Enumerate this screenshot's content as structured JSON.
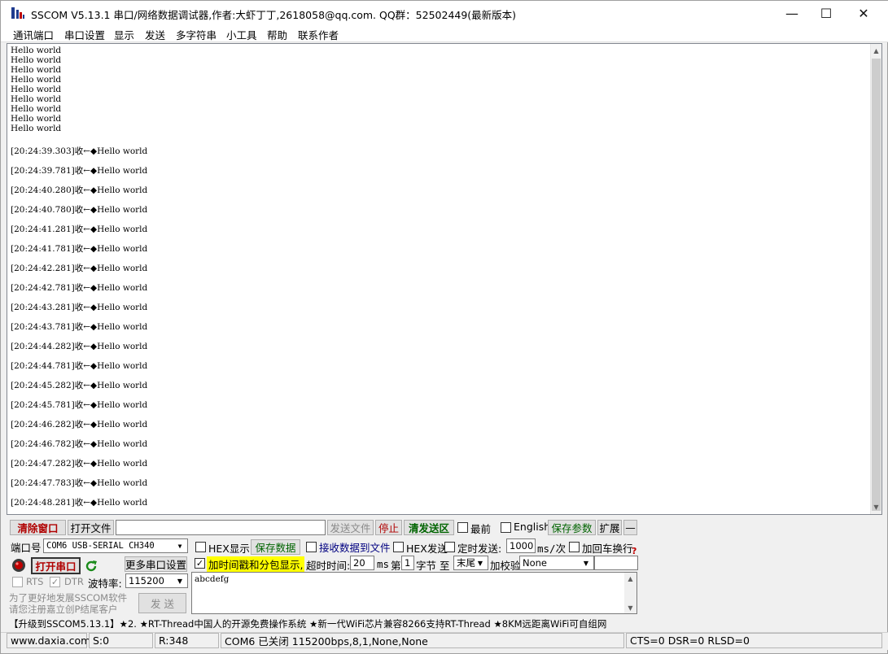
{
  "window": {
    "title": "SSCOM V5.13.1 串口/网络数据调试器,作者:大虾丁丁,2618058@qq.com. QQ群：52502449(最新版本)",
    "minimize": "—",
    "maximize": "☐",
    "close": "✕"
  },
  "menu": [
    "通讯端口",
    "串口设置",
    "显示",
    "发送",
    "多字符串",
    "小工具",
    "帮助",
    "联系作者"
  ],
  "receive": {
    "lines": [
      "Hello world",
      "Hello world",
      "Hello world",
      "Hello world",
      "Hello world",
      "Hello world",
      "Hello world",
      "Hello world",
      "Hello world"
    ],
    "timestamped": [
      "[20:24:39.303]收←◆Hello world",
      "[20:24:39.781]收←◆Hello world",
      "[20:24:40.280]收←◆Hello world",
      "[20:24:40.780]收←◆Hello world",
      "[20:24:41.281]收←◆Hello world",
      "[20:24:41.781]收←◆Hello world",
      "[20:24:42.281]收←◆Hello world",
      "[20:24:42.781]收←◆Hello world",
      "[20:24:43.281]收←◆Hello world",
      "[20:24:43.781]收←◆Hello world",
      "[20:24:44.282]收←◆Hello world",
      "[20:24:44.781]收←◆Hello world",
      "[20:24:45.282]收←◆Hello world",
      "[20:24:45.781]收←◆Hello world",
      "[20:24:46.282]收←◆Hello world",
      "[20:24:46.782]收←◆Hello world",
      "[20:24:47.282]收←◆Hello world",
      "[20:24:47.783]收←◆Hello world",
      "[20:24:48.281]收←◆Hello world"
    ]
  },
  "toolbar": {
    "clear_window": "清除窗口",
    "open_file": "打开文件",
    "file_path": "",
    "send_file": "发送文件",
    "stop": "停止",
    "clear_send": "清发送区",
    "topmost": "最前",
    "english": "English",
    "save_params": "保存参数",
    "expand": "扩展",
    "collapse": "—"
  },
  "port": {
    "port_label": "端口号",
    "port_value": "COM6 USB-SERIAL CH340",
    "open_port": "打开串口",
    "more_settings": "更多串口设置",
    "rts": "RTS",
    "dtr": "DTR",
    "baud_label": "波特率:",
    "baud_value": "115200"
  },
  "options": {
    "hex_display": "HEX显示",
    "save_data": "保存数据",
    "recv_to_file": "接收数据到文件",
    "hex_send": "HEX发送",
    "timed_send": "定时发送:",
    "interval_value": "1000",
    "interval_unit": "ms/次",
    "add_crlf": "加回车换行",
    "timestamp_split": "加时间戳和分包显示,",
    "timeout_label": "超时时间:",
    "timeout_value": "20",
    "timeout_unit": "ms",
    "byte_prefix": "第",
    "byte_value": "1",
    "byte_suffix": "字节 至",
    "end_value": "末尾",
    "checksum_label": "加校验",
    "checksum_value": "None",
    "help": "?"
  },
  "send": {
    "text": "abcdefg",
    "send_button": "发  送"
  },
  "promo": {
    "left_line1": "为了更好地发展SSCOM软件",
    "left_line2": "请您注册嘉立创P结尾客户",
    "ticker": "【升级到SSCOM5.13.1】★2. ★RT-Thread中国人的开源免费操作系统 ★新一代WiFi芯片兼容8266支持RT-Thread ★8KM远距离WiFi可自组网"
  },
  "status": {
    "website": "www.daxia.com",
    "sent": "S:0",
    "received": "R:348",
    "port_state": "COM6 已关闭  115200bps,8,1,None,None",
    "lines": "CTS=0 DSR=0 RLSD=0"
  },
  "colors": {
    "accent_red": "#b00000",
    "accent_green": "#006400",
    "highlight_yellow": "#ffff00",
    "icon_red": "#c00000"
  }
}
